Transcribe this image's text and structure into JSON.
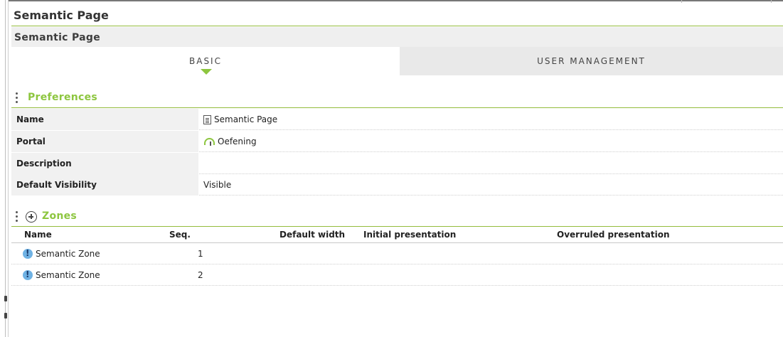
{
  "header": {
    "title": "Semantic Page"
  },
  "subheader": {
    "title": "Semantic Page"
  },
  "tabs": [
    {
      "label": "BASIC",
      "active": true
    },
    {
      "label": "USER MANAGEMENT",
      "active": false
    }
  ],
  "preferences": {
    "title": "Preferences",
    "rows": [
      {
        "label": "Name",
        "value": "Semantic Page",
        "icon": "document-icon"
      },
      {
        "label": "Portal",
        "value": "Oefening",
        "icon": "portal-icon"
      },
      {
        "label": "Description",
        "value": ""
      },
      {
        "label": "Default Visibility",
        "value": "Visible"
      }
    ]
  },
  "zones": {
    "title": "Zones",
    "columns": [
      "Name",
      "Seq.",
      "Default width",
      "Initial presentation",
      "Overruled presentation"
    ],
    "rows": [
      {
        "name": "Semantic Zone",
        "seq": "1",
        "icon": "warning-icon"
      },
      {
        "name": "Semantic Zone",
        "seq": "2",
        "icon": "warning-icon"
      }
    ]
  },
  "colors": {
    "accent": "#8dc63f",
    "label_bg": "#f1f1f1",
    "tab_inactive_bg": "#e9e9e9"
  }
}
